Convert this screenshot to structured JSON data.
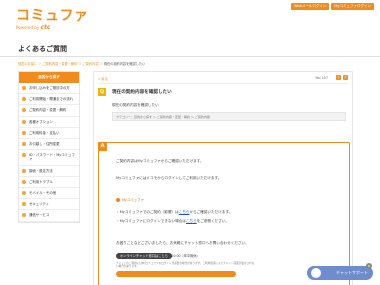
{
  "header": {
    "logo": "コミュファ",
    "logo_sub_prefix": "Powered by",
    "logo_sub_brand": "ctc",
    "links": [
      "Webメールログイン",
      "Myコミュファログイン"
    ]
  },
  "page": {
    "title": "よくあるご質問"
  },
  "breadcrumb": {
    "items": [
      "回答のお探し",
      "ご契約内容・変更・解約",
      "ご契約内容",
      "現在の契約内容を確認したい"
    ]
  },
  "sidebar": {
    "heading": "目的から探す",
    "items": [
      "お申し込みをご検討中の方",
      "ご利用開始・開通までの流れ",
      "ご契約内容・変更・解約",
      "各種オプション",
      "ご利用料金・支払い",
      "お引越し・住所変更",
      "ID・パスワード・Myコミュファ",
      "接続・設定方法",
      "ご利用トラブル",
      "モバイル・その他",
      "セキュリティ",
      "通信サービス"
    ]
  },
  "main": {
    "back_label": "« 戻る",
    "page_num": "No: 157",
    "font_buttons": [
      "小",
      "大"
    ],
    "question_mark": "Q",
    "question_title": "現在の契約内容を確認したい",
    "question_body": "現在の契約内容を確認したい",
    "category_path": "カテゴリー：目的から探す ＞ ご契約内容・変更・解約 ＞ ご契約内容",
    "answer_mark": "A",
    "answer_line1": "ご契約内容はMyコミュファからご確認いただけます。",
    "answer_line2": "Myコミュファにはドコモからログインしてご利用いただけます。",
    "mycommufa_label": "Myコミュファ",
    "bullet1_pre": "・Myコミュファでのご契約（影響）は",
    "bullet1_link": "こちら",
    "bullet1_post": "からご確認いただけます。",
    "bullet2_pre": "・Myコミュファにログインできない場合は",
    "bullet2_link": "こちら",
    "bullet2_post": "をご参照ください。",
    "closing": "お困りごとなどございましたら、お気軽にチャット窓口へお問い合わせください。",
    "chat_label": "オンラインチャット窓口は",
    "chat_link": "こちら",
    "chat_hours": "9:00 ～ 20:00（年中無休）",
    "chat_note": "チャットのご利用にはMyコミュファのログインが必要な場合があります。ご利用環境によりチャット画面が表示されない場合があります。"
  },
  "floating": {
    "label": "チャットサポート",
    "close": "×"
  }
}
